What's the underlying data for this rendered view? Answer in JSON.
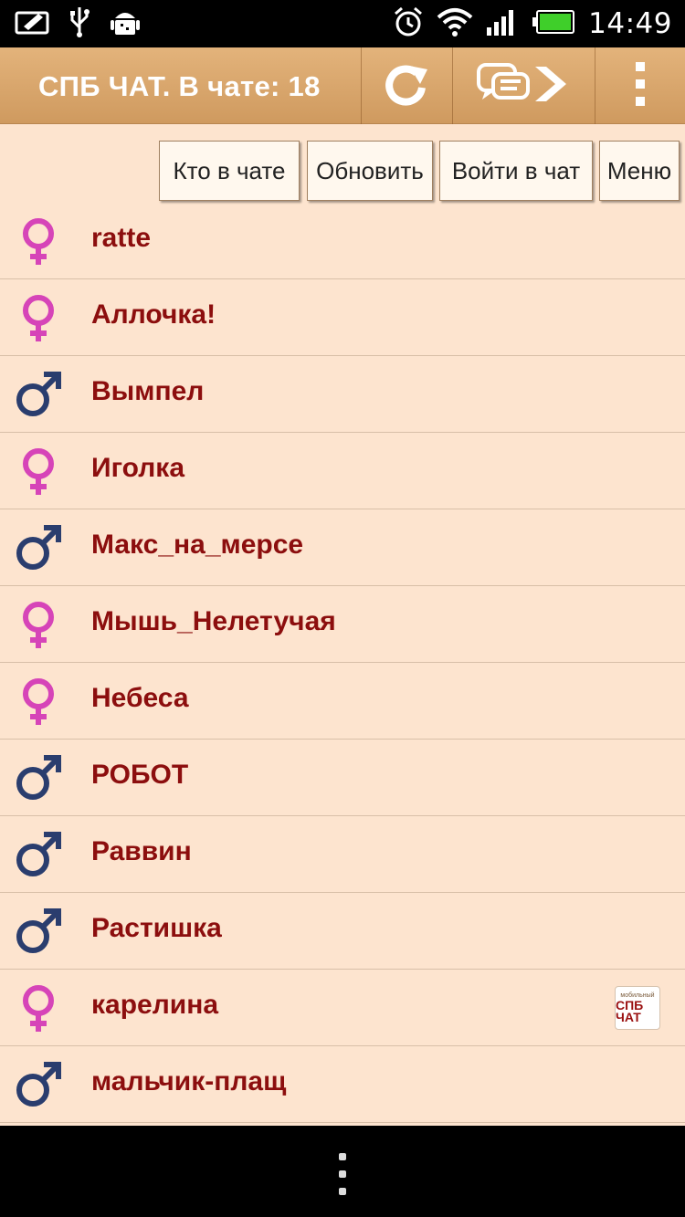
{
  "status_bar": {
    "time": "14:49"
  },
  "action_bar": {
    "title": "СПБ ЧАТ. В чате: 18"
  },
  "hints": [
    {
      "label": "Кто в чате"
    },
    {
      "label": "Обновить"
    },
    {
      "label": "Войти в чат"
    },
    {
      "label": "Меню"
    }
  ],
  "colors": {
    "female": "#d644b8",
    "male": "#2a3d6e",
    "name": "#8c0e0e",
    "background": "#fde4cf",
    "actionbar": "#d9a76c"
  },
  "users": [
    {
      "name": "ratte",
      "gender": "female"
    },
    {
      "name": "Аллочка!",
      "gender": "female"
    },
    {
      "name": "Вымпел",
      "gender": "male"
    },
    {
      "name": "Иголка",
      "gender": "female"
    },
    {
      "name": "Макс_на_мерсе",
      "gender": "male"
    },
    {
      "name": "Мышь_Нелетучая",
      "gender": "female"
    },
    {
      "name": "Небеса",
      "gender": "female"
    },
    {
      "name": "РОБОТ",
      "gender": "male"
    },
    {
      "name": "Раввин",
      "gender": "male"
    },
    {
      "name": "Растишка",
      "gender": "male"
    },
    {
      "name": "карелина",
      "gender": "female",
      "badge": {
        "line1": "мобильный",
        "line2": "СПБ ЧАТ"
      }
    },
    {
      "name": "мальчик-плащ",
      "gender": "male"
    }
  ]
}
